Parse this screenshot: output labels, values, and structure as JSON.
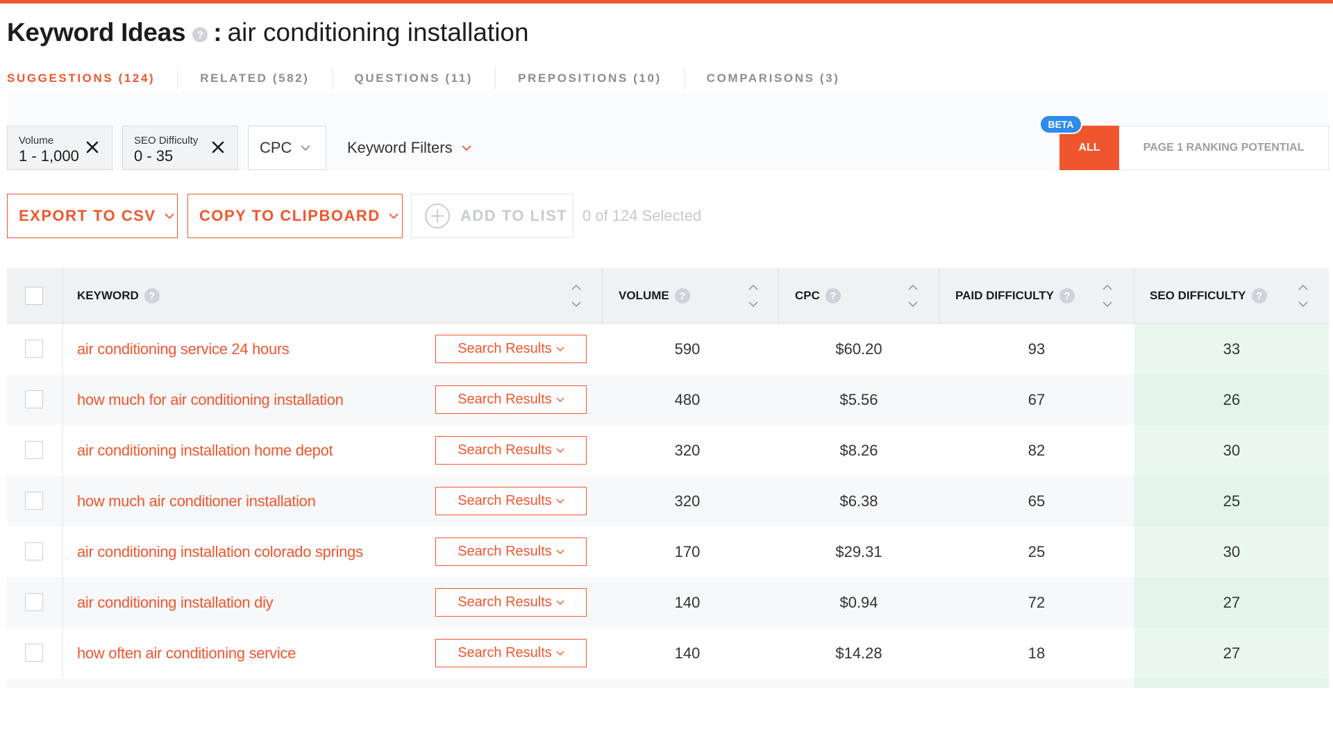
{
  "title": {
    "main": "Keyword Ideas",
    "help": "?",
    "separator": ":",
    "keyword": "air conditioning installation"
  },
  "tabs": [
    {
      "label": "SUGGESTIONS (124)"
    },
    {
      "label": "RELATED (582)"
    },
    {
      "label": "QUESTIONS (11)"
    },
    {
      "label": "PREPOSITIONS (10)"
    },
    {
      "label": "COMPARISONS (3)"
    }
  ],
  "filters": {
    "volume": {
      "label": "Volume",
      "value": "1 - 1,000"
    },
    "seo_difficulty": {
      "label": "SEO Difficulty",
      "value": "0 - 35"
    },
    "cpc_label": "CPC",
    "keyword_filters_label": "Keyword Filters"
  },
  "segment": {
    "beta": "BETA",
    "all": "ALL",
    "ranking": "PAGE 1 RANKING POTENTIAL"
  },
  "actions": {
    "export": "EXPORT TO CSV",
    "copy": "COPY TO CLIPBOARD",
    "add": "ADD TO LIST",
    "selected": "0 of 124 Selected"
  },
  "table": {
    "headers": {
      "keyword": "KEYWORD",
      "volume": "VOLUME",
      "cpc": "CPC",
      "paid": "PAID DIFFICULTY",
      "seo": "SEO DIFFICULTY"
    },
    "search_results_label": "Search Results",
    "rows": [
      {
        "keyword": "air conditioning service 24 hours",
        "volume": "590",
        "cpc": "$60.20",
        "paid": "93",
        "seo": "33"
      },
      {
        "keyword": "how much for air conditioning installation",
        "volume": "480",
        "cpc": "$5.56",
        "paid": "67",
        "seo": "26"
      },
      {
        "keyword": "air conditioning installation home depot",
        "volume": "320",
        "cpc": "$8.26",
        "paid": "82",
        "seo": "30"
      },
      {
        "keyword": "how much air conditioner installation",
        "volume": "320",
        "cpc": "$6.38",
        "paid": "65",
        "seo": "25"
      },
      {
        "keyword": "air conditioning installation colorado springs",
        "volume": "170",
        "cpc": "$29.31",
        "paid": "25",
        "seo": "30"
      },
      {
        "keyword": "air conditioning installation diy",
        "volume": "140",
        "cpc": "$0.94",
        "paid": "72",
        "seo": "27"
      },
      {
        "keyword": "how often air conditioning service",
        "volume": "140",
        "cpc": "$14.28",
        "paid": "18",
        "seo": "27"
      }
    ]
  },
  "colors": {
    "accent": "#f0562e",
    "beta": "#2e8cea",
    "seo_column": "#e9f7ef"
  },
  "icons": [
    "help-icon",
    "close-icon",
    "chevron-down-icon",
    "plus-circle-icon",
    "sort-icon",
    "checkbox"
  ]
}
